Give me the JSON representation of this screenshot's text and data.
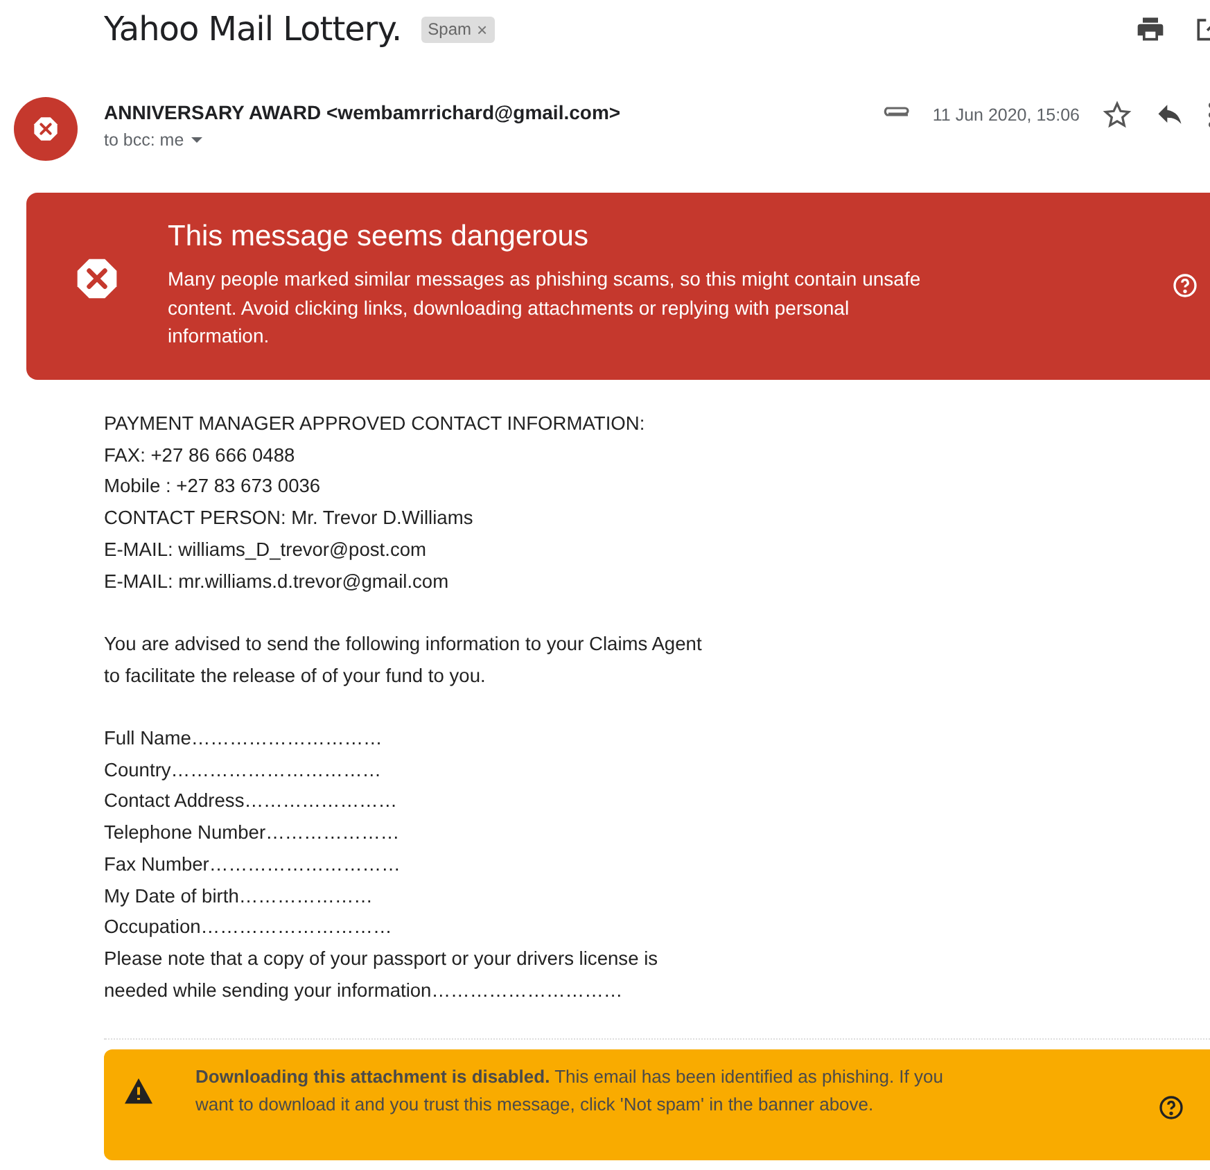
{
  "subject": {
    "title": "Yahoo Mail Lottery.",
    "label": "Spam",
    "label_remove": "×"
  },
  "sender": {
    "name": "ANNIVERSARY AWARD <wembamrrichard@gmail.com>",
    "recipients": "to bcc: me",
    "date": "11 Jun 2020, 15:06",
    "has_attachment": true,
    "starred": false
  },
  "warning": {
    "title": "This message seems dangerous",
    "text": "Many people marked similar messages as phishing scams, so this might contain unsafe content. Avoid clicking links, downloading attachments or replying with personal information."
  },
  "body": [
    [
      "PAYMENT MANAGER APPROVED CONTACT INFORMATION:",
      "FAX: +27 86 666 0488",
      "Mobile : +27 83 673 0036",
      "CONTACT PERSON: Mr. Trevor D.Williams",
      "E-MAIL: williams_D_trevor@post.com",
      "E-MAIL: mr.williams.d.trevor@gmail.com"
    ],
    [
      "You are advised to send the following information to your Claims Agent",
      "to facilitate the release of of your fund to you."
    ],
    [
      "Full Name…………………………",
      "Country……………………………",
      "Contact Address……………………",
      "Telephone Number…………………",
      "Fax Number…………………………",
      "My Date of birth…………………",
      "Occupation…………………………",
      "Please note that a copy of your passport or your drivers license is",
      "needed while sending your information…………………………"
    ]
  ],
  "attachment_notice": {
    "text": "**Downloading this attachment is disabled.** This email has been identified as phishing. If you want to download it and you trust this message, click 'Not spam' in the banner above."
  }
}
